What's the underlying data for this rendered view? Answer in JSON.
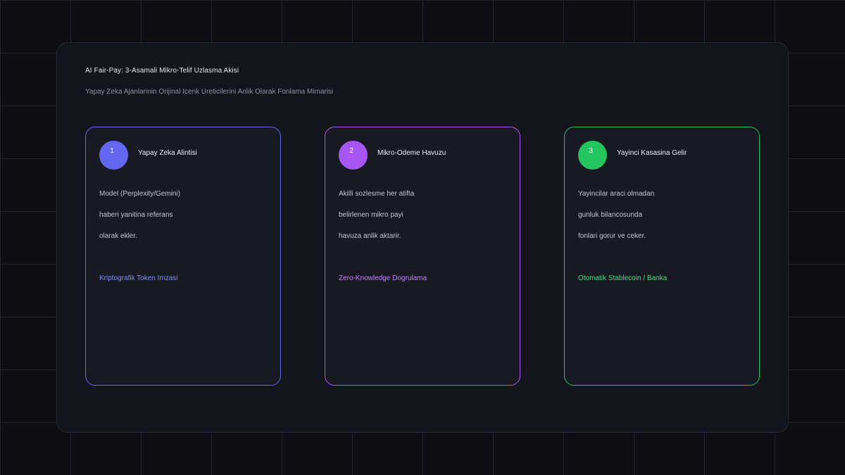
{
  "header": {
    "title": "AI Fair-Pay: 3-Asamali Mikro-Telif Uzlasma Akisi",
    "subtitle": "Yapay Zeka Ajanlarinin Orijinal Icerik Ureticilerini Anlik Olarak Fonlama Mimarisi"
  },
  "steps": [
    {
      "number": "1",
      "title": "Yapay Zeka Alintisi",
      "lines": [
        "Model (Perplexity/Gemini)",
        "haberi yanitina referans",
        "olarak ekler."
      ],
      "tech": "Kriptografik Token Imzasi",
      "color": "#6366f1"
    },
    {
      "number": "2",
      "title": "Mikro-Odeme Havuzu",
      "lines": [
        "Akilli sozlesme her atifta",
        "belirlenen mikro payi",
        "havuza anlik aktarir."
      ],
      "tech": "Zero-Knowledge Dogrulama",
      "color": "#a855f7"
    },
    {
      "number": "3",
      "title": "Yayinci Kasasina Gelir",
      "lines": [
        "Yayincilar araci olmadan",
        "gunluk bilancosunda",
        "fonlari gorur ve ceker."
      ],
      "tech": "Otomatik Stablecoin / Banka",
      "color": "#22c55e"
    }
  ]
}
